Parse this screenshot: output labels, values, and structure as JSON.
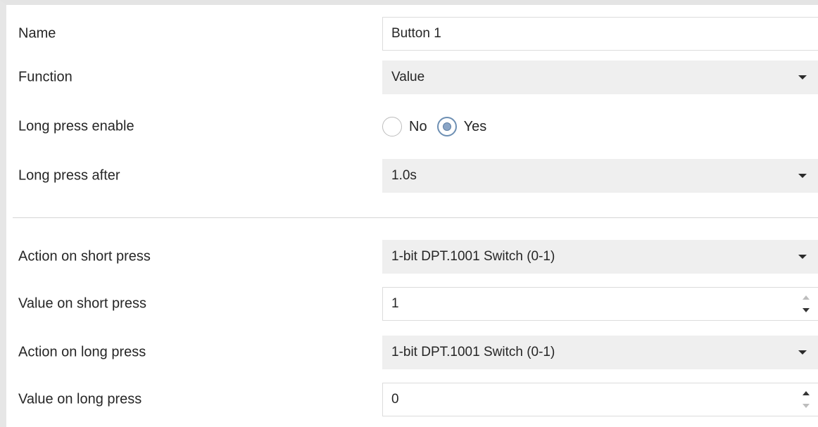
{
  "fields": {
    "name": {
      "label": "Name",
      "value": "Button 1"
    },
    "function": {
      "label": "Function",
      "value": "Value"
    },
    "long_press_enable": {
      "label": "Long press enable",
      "options": [
        {
          "label": "No",
          "selected": false
        },
        {
          "label": "Yes",
          "selected": true
        }
      ]
    },
    "long_press_after": {
      "label": "Long press after",
      "value": "1.0s"
    },
    "action_short": {
      "label": "Action on short press",
      "value": "1-bit DPT.1001 Switch (0-1)"
    },
    "value_short": {
      "label": "Value on short press",
      "value": "1"
    },
    "action_long": {
      "label": "Action on long press",
      "value": "1-bit DPT.1001 Switch (0-1)"
    },
    "value_long": {
      "label": "Value on long press",
      "value": "0"
    }
  },
  "colors": {
    "dropdown_bg": "#efefef",
    "radio_selected": "#6d8fb3",
    "divider": "#d5d5d5"
  },
  "icons": {
    "dropdown": "chevron-down-icon",
    "spin_up": "spin-up-icon",
    "spin_down": "spin-down-icon",
    "radio": "radio-icon"
  }
}
